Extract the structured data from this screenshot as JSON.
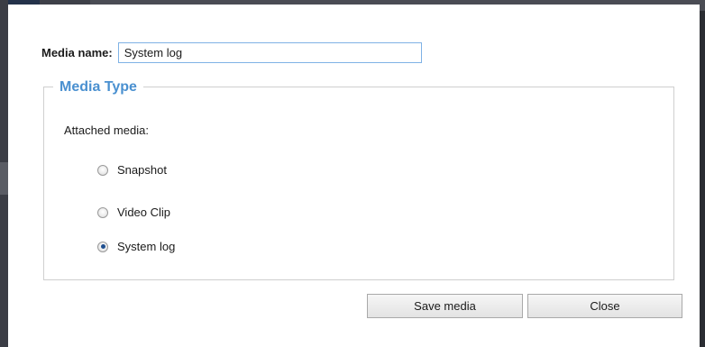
{
  "media_name": {
    "label": "Media name:",
    "value": "System log"
  },
  "media_type": {
    "legend": "Media Type",
    "attached_label": "Attached media:",
    "options": [
      {
        "label": "Snapshot",
        "checked": false
      },
      {
        "label": "Video Clip",
        "checked": false
      },
      {
        "label": "System log",
        "checked": true
      }
    ]
  },
  "buttons": {
    "save_label": "Save media",
    "close_label": "Close"
  },
  "colors": {
    "legend": "#4a90d0",
    "input_border": "#7fb2e5",
    "group_border": "#cfcfcf"
  }
}
